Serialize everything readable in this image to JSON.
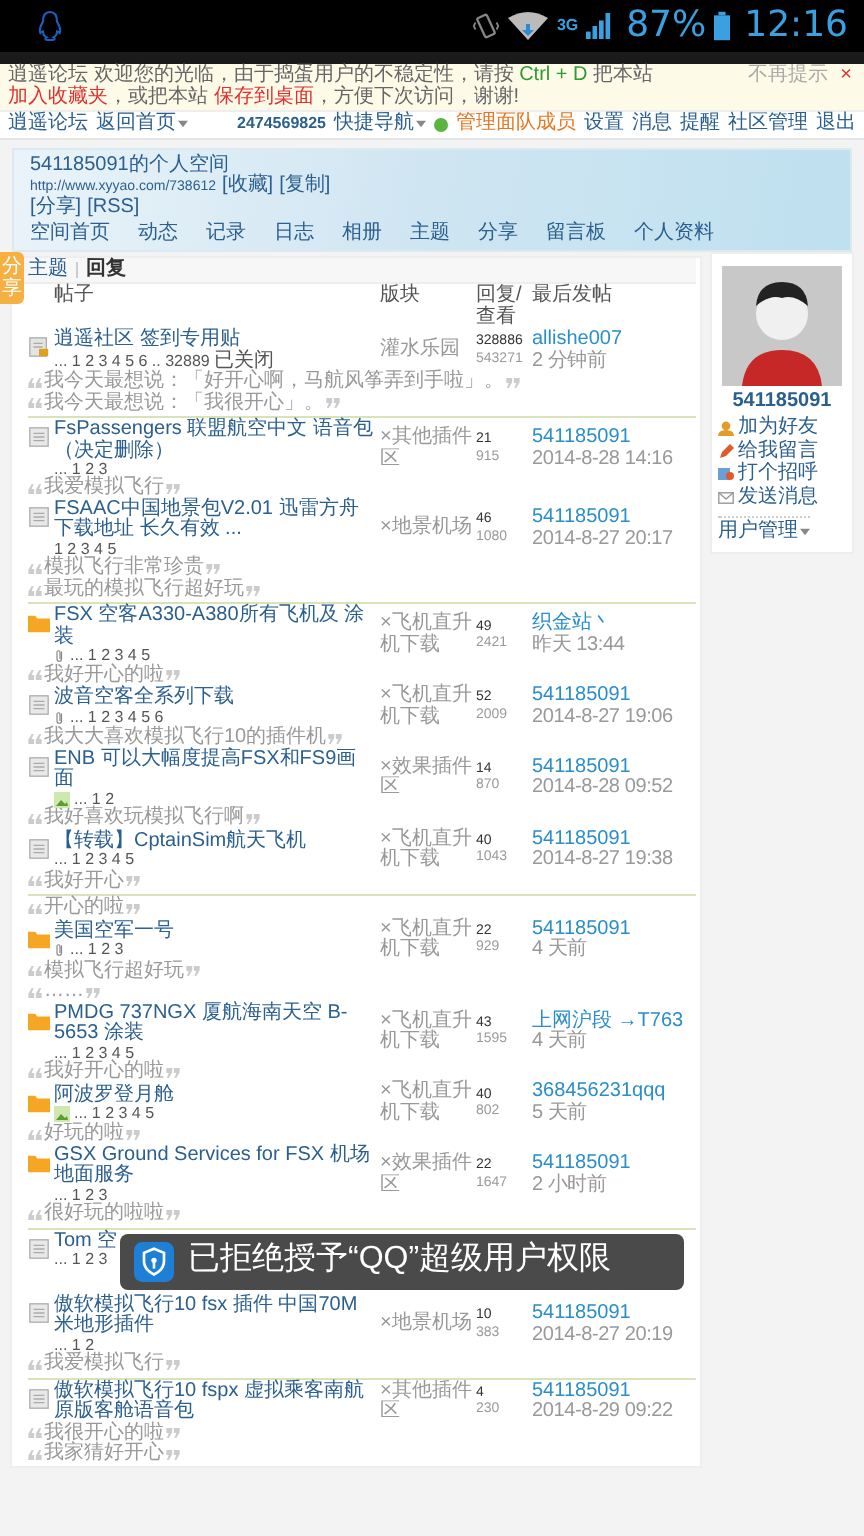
{
  "status_bar": {
    "network": "3G",
    "battery": "87%",
    "time": "12:16"
  },
  "notice": {
    "parts": [
      {
        "kind": "plain",
        "text": "逍遥论坛 欢迎您的光临，由于捣蛋用户的不稳定性，请按 "
      },
      {
        "kind": "key",
        "text": "Ctrl + D"
      },
      {
        "kind": "plain",
        "text": " 把本站 "
      },
      {
        "kind": "link",
        "text": "加入收藏夹"
      },
      {
        "kind": "plain",
        "text": "，或把本站 "
      },
      {
        "kind": "link",
        "text": "保存到桌面"
      },
      {
        "kind": "plain",
        "text": "，方便下次访问，谢谢!"
      }
    ],
    "dismiss": "不再提示",
    "close": "×"
  },
  "topbar": {
    "left": [
      {
        "text": "逍遥论坛",
        "dropdown": false
      },
      {
        "text": "返回首页",
        "dropdown": true
      }
    ],
    "right": [
      {
        "kind": "user",
        "text": "2474569825"
      },
      {
        "kind": "link",
        "text": "快捷导航",
        "dropdown": true
      },
      {
        "kind": "badge",
        "text": "管理面队成员"
      },
      {
        "kind": "link",
        "text": "设置",
        "dropdown": false
      },
      {
        "kind": "link",
        "text": "消息",
        "dropdown": false
      },
      {
        "kind": "link",
        "text": "提醒",
        "dropdown": false
      },
      {
        "kind": "link",
        "text": "社区管理",
        "dropdown": false
      },
      {
        "kind": "link",
        "text": "退出",
        "dropdown": false
      }
    ]
  },
  "space": {
    "title": "541185091的个人空间",
    "url": "http://www.xyyao.com/738612",
    "url_links": [
      "[收藏]",
      "[复制]"
    ],
    "extra_links": [
      "[分享]",
      "[RSS]"
    ],
    "nav": [
      "空间首页",
      "动态",
      "记录",
      "日志",
      "相册",
      "主题",
      "分享",
      "留言板",
      "个人资料"
    ]
  },
  "side_tab": "分享",
  "tabs": [
    {
      "label": "主题",
      "selected": false
    },
    {
      "label": "回复",
      "selected": true
    }
  ],
  "columns": [
    "帖子",
    "版块",
    "回复/查看",
    "最后发帖"
  ],
  "entries": [
    {
      "kind": "locked_thread",
      "title": "逍遥社区 签到专用贴",
      "pages": "... 1 2 3 4 5 6 .. 32889",
      "status": "已关闭",
      "forum": "灌水乐园",
      "replies": "328886",
      "views": "543271",
      "last_user": "allishe007",
      "last_time": "2 分钟前"
    },
    {
      "kind": "quote",
      "text": "我今天最想说：「好开心啊，马航风筝弄到手啦」。"
    },
    {
      "kind": "quote",
      "text": "我今天最想说：「我很开心」。"
    },
    {
      "kind": "divider"
    },
    {
      "kind": "thread",
      "title": "FsPassengers 联盟航空中文 语音包（决定删除）",
      "pages": "... 1 2 3",
      "forum": "×其他插件区",
      "replies": "21",
      "views": "915",
      "last_user": "541185091",
      "last_time": "2014-8-28 14:16"
    },
    {
      "kind": "quote",
      "text": "我爱模拟飞行"
    },
    {
      "kind": "thread",
      "title": "FSAAC中国地景包V2.01 迅雷方舟下载地址 长久有效 ...",
      "pages": "1 2 3 4 5",
      "forum": "×地景机场",
      "replies": "46",
      "views": "1080",
      "last_user": "541185091",
      "last_time": "2014-8-27 20:17"
    },
    {
      "kind": "quote",
      "text": "模拟飞行非常珍贵"
    },
    {
      "kind": "quote",
      "text": "最玩的模拟飞行超好玩"
    },
    {
      "kind": "divider"
    },
    {
      "kind": "hot_thread",
      "title": "FSX 空客A330-A380所有飞机及 涂装",
      "has_attachment": true,
      "pages": "... 1 2 3 4 5",
      "forum": "×飞机直升机下载",
      "replies": "49",
      "views": "2421",
      "last_user": "织金站丶",
      "last_time": "昨天 13:44"
    },
    {
      "kind": "quote",
      "text": "我好开心的啦"
    },
    {
      "kind": "thread",
      "title": "波音空客全系列下载",
      "has_attachment": true,
      "pages": "... 1 2 3 4 5 6",
      "forum": "×飞机直升机下载",
      "replies": "52",
      "views": "2009",
      "last_user": "541185091",
      "last_time": "2014-8-27 19:06"
    },
    {
      "kind": "quote",
      "text": "我大大喜欢模拟飞行10的插件机"
    },
    {
      "kind": "thread",
      "title": "ENB 可以大幅度提高FSX和FS9画面",
      "has_image": true,
      "pages": "... 1 2",
      "forum": "×效果插件区",
      "replies": "14",
      "views": "870",
      "last_user": "541185091",
      "last_time": "2014-8-28 09:52"
    },
    {
      "kind": "quote",
      "text": "我好喜欢玩模拟飞行啊"
    },
    {
      "kind": "thread",
      "title": "【转载】CptainSim航天飞机",
      "pages": "... 1 2 3 4 5",
      "forum": "×飞机直升机下载",
      "replies": "40",
      "views": "1043",
      "last_user": "541185091",
      "last_time": "2014-8-27 19:38"
    },
    {
      "kind": "quote",
      "text": "我好开心"
    },
    {
      "kind": "divider"
    },
    {
      "kind": "quote",
      "text": "开心的啦"
    },
    {
      "kind": "hot_thread",
      "title": "美国空军一号",
      "has_attachment": true,
      "pages": "... 1 2 3",
      "forum": "×飞机直升机下载",
      "replies": "22",
      "views": "929",
      "last_user": "541185091",
      "last_time": "4 天前"
    },
    {
      "kind": "quote",
      "text": "模拟飞行超好玩"
    },
    {
      "kind": "quote",
      "text": "……"
    },
    {
      "kind": "hot_thread",
      "title": "PMDG 737NGX 厦航海南天空 B-5653 涂装",
      "pages": "... 1 2 3 4 5",
      "forum": "×飞机直升机下载",
      "replies": "43",
      "views": "1595",
      "last_user": "上网沪段 →T763",
      "last_time": "4 天前"
    },
    {
      "kind": "quote",
      "text": "我好开心的啦"
    },
    {
      "kind": "hot_thread",
      "title": "阿波罗登月舱",
      "has_image": true,
      "pages": "... 1 2 3 4 5",
      "forum": "×飞机直升机下载",
      "replies": "40",
      "views": "802",
      "last_user": "368456231qqq",
      "last_time": "5 天前"
    },
    {
      "kind": "quote",
      "text": "好玩的啦"
    },
    {
      "kind": "hot_thread",
      "title": "GSX Ground Services for FSX 机场地面服务",
      "pages": "... 1 2 3",
      "forum": "×效果插件区",
      "replies": "22",
      "views": "1647",
      "last_user": "541185091",
      "last_time": "2 小时前"
    },
    {
      "kind": "quote",
      "text": "很好玩的啦啦"
    },
    {
      "kind": "divider"
    },
    {
      "kind": "thread",
      "title": "Tom 空",
      "pages": "... 1 2 3",
      "overlay": "已拒绝授予“QQ”超级用户权限"
    },
    {
      "kind": "thread",
      "title": "傲软模拟飞行10 fsx 插件 中国70M米地形插件",
      "pages": "... 1 2",
      "forum": "×地景机场",
      "replies": "10",
      "views": "383",
      "last_user": "541185091",
      "last_time": "2014-8-27 20:19"
    },
    {
      "kind": "quote",
      "text": "我爱模拟飞行"
    },
    {
      "kind": "divider"
    },
    {
      "kind": "thread",
      "title": "傲软模拟飞行10 fspx 虚拟乘客南航原版客舱语音包",
      "forum": "×其他插件区",
      "replies": "4",
      "views": "230",
      "last_user": "541185091",
      "last_time": "2014-8-29 09:22"
    },
    {
      "kind": "quote",
      "text": "我很开心的啦"
    },
    {
      "kind": "quote",
      "text": "我家猜好开心"
    }
  ],
  "profile": {
    "name": "541185091",
    "actions": [
      "加为好友",
      "给我留言",
      "打个招呼",
      "发送消息"
    ],
    "menu": "用户管理"
  }
}
